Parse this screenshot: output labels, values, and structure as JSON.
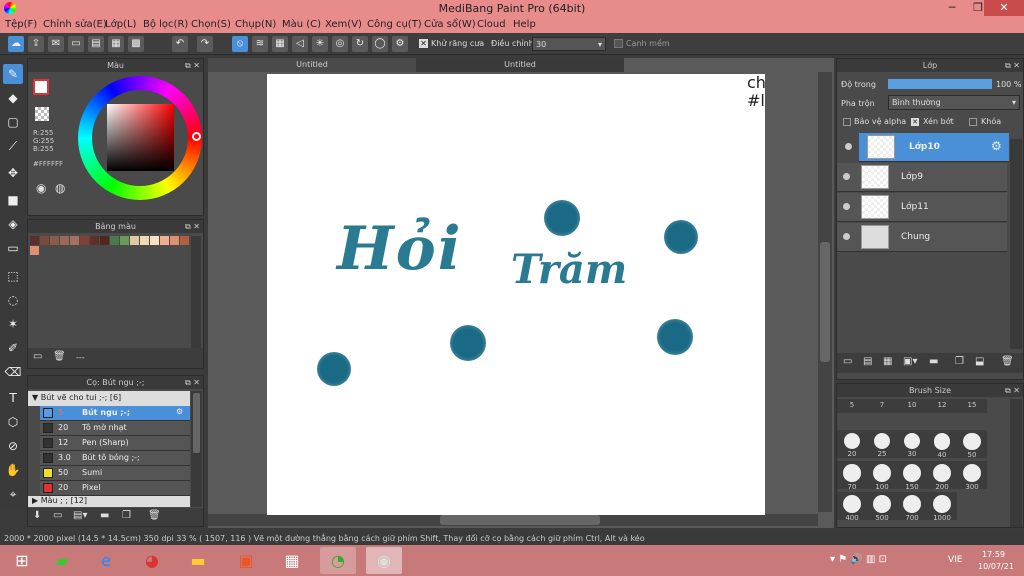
{
  "window": {
    "title": "MediBang Paint Pro (64bit)",
    "min": "─",
    "max": "❐",
    "close": "✕"
  },
  "menu": [
    "Tệp(F)",
    "Chỉnh sửa(E)",
    "Lớp(L)",
    "Bộ lọc(R)",
    "Chọn(S)",
    "Chụp(N)",
    "Màu (C)",
    "Xem(V)",
    "Công cụ(T)",
    "Cửa sổ(W)",
    "Cloud",
    "Help"
  ],
  "toolbar": {
    "antialias_label": "Khử răng cưa",
    "adjust_label": "Điều chỉnh",
    "adjust_value": "30",
    "soft_edge_label": "Cạnh mềm"
  },
  "color_panel": {
    "title": "Màu",
    "r": "R:255",
    "g": "G:255",
    "b": "B:255",
    "hex": "#FFFFFF"
  },
  "palette_panel": {
    "title": "Bảng màu",
    "footer": "---"
  },
  "palette_colors": [
    "#5a2f2a",
    "#7a4a40",
    "#8a5a4a",
    "#9a6a58",
    "#a87060",
    "#804038",
    "#603028",
    "#502820",
    "#4a7a4a",
    "#6a9a5a",
    "#e0c8a0",
    "#f0d8b0",
    "#f5e0c0",
    "#f0b090",
    "#e09070",
    "#b06040"
  ],
  "brush_panel": {
    "title": "Cọ: Bút ngu ;-;",
    "group": "Bút vẽ cho tui ;-; [6]",
    "group2": "Màu ; ; [12]",
    "brushes": [
      {
        "size": "5",
        "name": "Bút ngu ;-;",
        "color": "#4a90d9"
      },
      {
        "size": "20",
        "name": "Tô mờ nhạt",
        "color": "#333333"
      },
      {
        "size": "12",
        "name": "Pen (Sharp)",
        "color": "#333333"
      },
      {
        "size": "3.0",
        "name": "Bút tô bóng ;-;",
        "color": "#333333"
      },
      {
        "size": "50",
        "name": "Sumi",
        "color": "#f0e020"
      },
      {
        "size": "20",
        "name": "Pixel",
        "color": "#e03030"
      }
    ]
  },
  "doc_tabs": [
    "Untitled",
    "Untitled"
  ],
  "canvas": {
    "text1": "Hỏi",
    "text2": "Trăm",
    "corner_text": "ch\n#l"
  },
  "layer_panel": {
    "title": "Lớp",
    "opacity_label": "Độ trong",
    "opacity_value": "100 %",
    "blend_label": "Pha trộn",
    "blend_value": "Bình thường",
    "protect_alpha": "Bảo vệ alpha",
    "clip": "Xén bớt",
    "lock": "Khóa",
    "layers": [
      {
        "name": "Lớp10"
      },
      {
        "name": "Lớp9"
      },
      {
        "name": "Lớp11"
      },
      {
        "name": "Chung"
      }
    ]
  },
  "brush_size_panel": {
    "title": "Brush Size",
    "sizes": [
      "5",
      "7",
      "10",
      "12",
      "15",
      "20",
      "25",
      "30",
      "40",
      "50",
      "70",
      "100",
      "150",
      "200",
      "300",
      "400",
      "500",
      "700",
      "1000"
    ]
  },
  "status": {
    "text": "2000 * 2000 pixel   (14.5 * 14.5cm)   350 dpi   33 %   ( 1507, 116 )   Vẽ một đường thẳng bằng cách giữ phím Shift, Thay đổi cỡ cọ bằng cách giữ phím Ctrl, Alt và kéo"
  },
  "taskbar": {
    "time": "17:59",
    "date": "10/07/21",
    "lang": "VIE"
  }
}
